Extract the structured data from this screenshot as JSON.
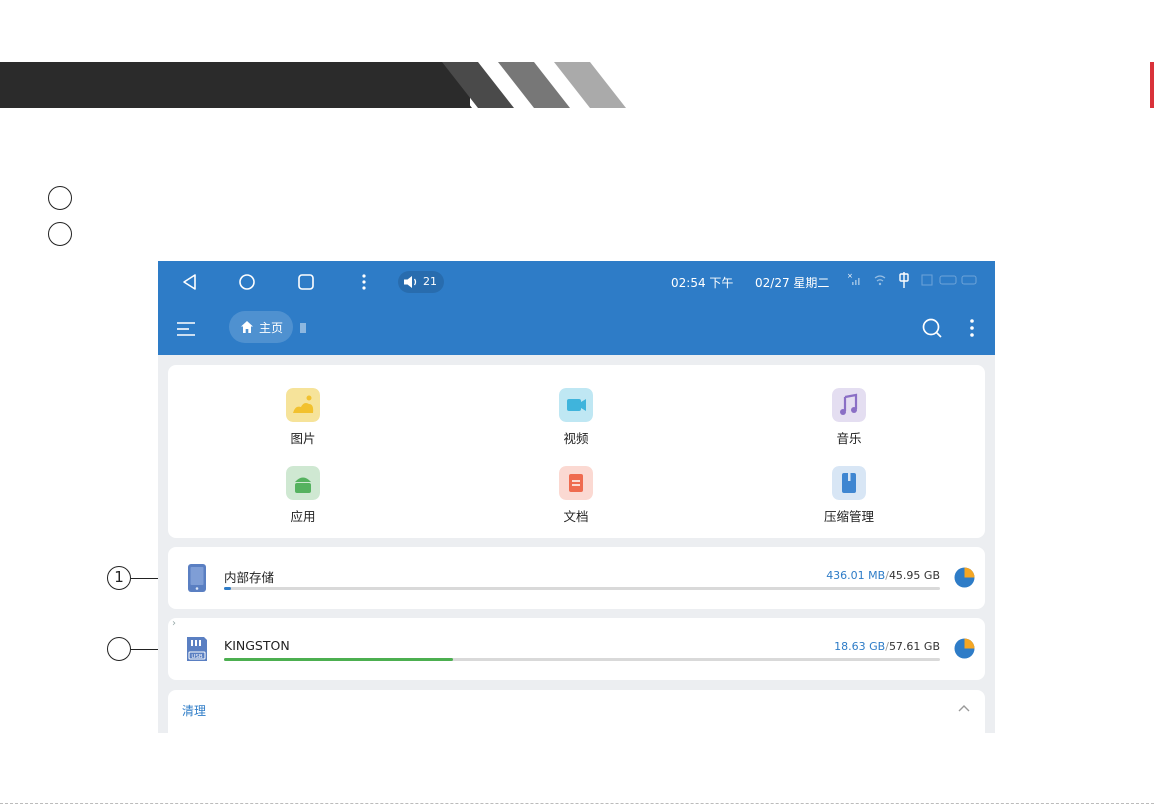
{
  "callouts": {
    "one": "1",
    "two": ""
  },
  "status_bar": {
    "volume": "21",
    "time": "02:54 下午",
    "date": "02/27 星期二",
    "bg_color": "#2e7cc7"
  },
  "app_bar": {
    "breadcrumb_home": "主页"
  },
  "categories": [
    {
      "label": "图片",
      "icon": "image-icon",
      "color": "#f6e39a"
    },
    {
      "label": "视频",
      "icon": "video-icon",
      "color": "#bfe7f3"
    },
    {
      "label": "音乐",
      "icon": "music-icon",
      "color": "#e4def1"
    },
    {
      "label": "应用",
      "icon": "android-icon",
      "color": "#cfe8d2"
    },
    {
      "label": "文档",
      "icon": "document-icon",
      "color": "#fbd9d2"
    },
    {
      "label": "压缩管理",
      "icon": "archive-icon",
      "color": "#d8e6f5"
    }
  ],
  "storage": [
    {
      "name": "内部存储",
      "used": "436.01 MB",
      "separator": "/",
      "total": "45.95 GB",
      "fraction": 0.01,
      "bar_color": "#2e7cc7"
    },
    {
      "name": "KINGSTON",
      "used": "18.63 GB",
      "separator": "/",
      "total": "57.61 GB",
      "fraction": 0.32,
      "bar_color": "#4caf50",
      "icon_text": "USB"
    }
  ],
  "clean_section": {
    "title": "清理"
  },
  "colors": {
    "accent": "#2e7cc7",
    "pie_orange": "#f5a623"
  }
}
